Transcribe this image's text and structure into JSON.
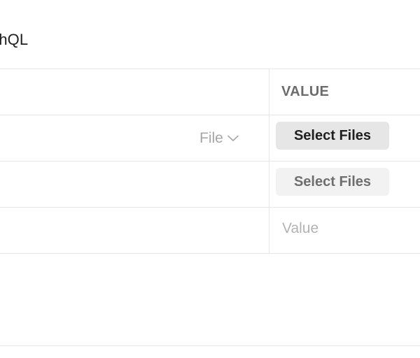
{
  "header": {
    "tab_label": "phQL"
  },
  "table": {
    "value_column_header": "VALUE",
    "rows": [
      {
        "type_label": "File",
        "button_label": "Select Files"
      },
      {
        "button_label": "Select Files"
      },
      {
        "value_placeholder": "Value"
      }
    ]
  },
  "icons": {
    "type_dropdown": "chevron-down-icon"
  },
  "colors": {
    "border": "#e6e6e6",
    "button_active_bg": "#e6e6e6",
    "button_inactive_bg": "#f2f2f2",
    "muted_text": "#a6a6a6",
    "placeholder_text": "#b3b3b3"
  }
}
